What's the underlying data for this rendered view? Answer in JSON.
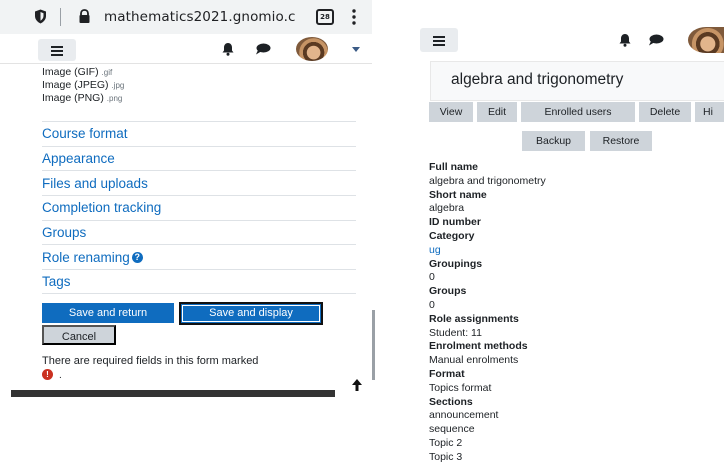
{
  "browser": {
    "url": "mathematics2021.gnomio.c",
    "tab_count": "28"
  },
  "left": {
    "file_types": [
      {
        "name": "Image (GIF)",
        "ext": ".gif"
      },
      {
        "name": "Image (JPEG)",
        "ext": ".jpg"
      },
      {
        "name": "Image (PNG)",
        "ext": ".png"
      }
    ],
    "menu": [
      "Course format",
      "Appearance",
      "Files and uploads",
      "Completion tracking",
      "Groups",
      "Role renaming",
      "Tags"
    ],
    "save_return": "Save and return",
    "save_display": "Save and display",
    "cancel": "Cancel",
    "required_text": "There are required fields in this form marked",
    "required_suffix": "."
  },
  "right": {
    "course_title": "algebra and trigonometry",
    "tabs": [
      "View",
      "Edit",
      "Enrolled users",
      "Delete",
      "Hi"
    ],
    "tabs2": [
      "Backup",
      "Restore"
    ],
    "details": {
      "full_name_label": "Full name",
      "full_name": "algebra and trigonometry",
      "short_name_label": "Short name",
      "short_name": "algebra",
      "id_number_label": "ID number",
      "category_label": "Category",
      "category": "ug",
      "groupings_label": "Groupings",
      "groupings": "0",
      "groups_label": "Groups",
      "groups": "0",
      "role_assign_label": "Role assignments",
      "role_assign": "Student: 11",
      "enrol_label": "Enrolment methods",
      "enrol": "Manual enrolments",
      "format_label": "Format",
      "format": "Topics format",
      "sections_label": "Sections",
      "sections": [
        "announcement",
        "sequence",
        "Topic 2",
        "Topic 3"
      ]
    }
  },
  "colors": {
    "link": "#0f6cbf",
    "primary_button": "#0f6cbf",
    "secondary_button": "#ced4da",
    "required_icon": "#ca3120"
  },
  "icons": [
    "shield-icon",
    "lock-icon",
    "tabs-icon",
    "more-vert-icon",
    "menu-icon",
    "bell-icon",
    "chat-icon",
    "avatar",
    "caret-down-icon",
    "help-icon",
    "required-icon",
    "arrow-up-icon"
  ]
}
